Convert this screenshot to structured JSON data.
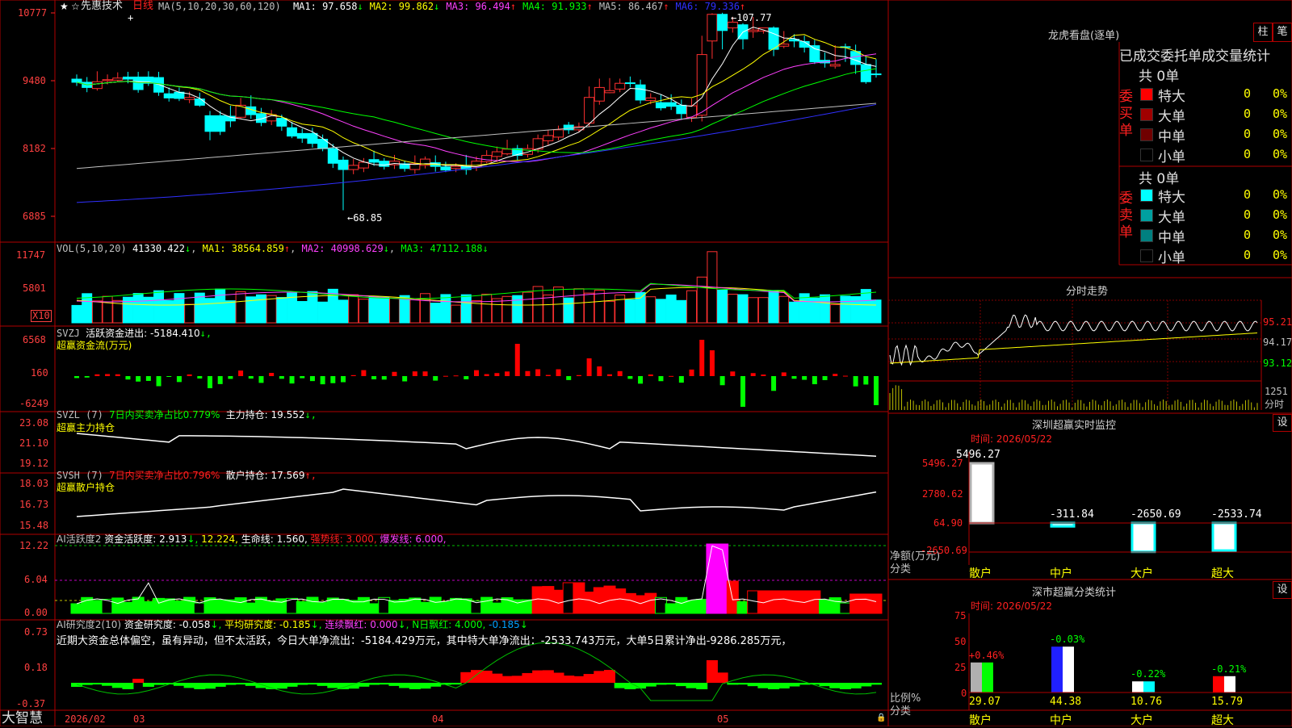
{
  "app": {
    "brand": "大智慧",
    "star_icon": "star-icon",
    "cursor_icon": "cursor-icon"
  },
  "header": {
    "stock": "先惠技术",
    "period": "日线",
    "ma_title": "MA(5,10,20,30,60,120)",
    "ma": [
      {
        "label": "MA1: 97.658",
        "arrow": "↓",
        "color": "#ffffff"
      },
      {
        "label": "MA2: 99.862",
        "arrow": "↓",
        "color": "#ffff00"
      },
      {
        "label": "MA3: 96.494",
        "arrow": "↑",
        "color": "#ff40ff"
      },
      {
        "label": "MA4: 91.933",
        "arrow": "↑",
        "color": "#00ff00"
      },
      {
        "label": "MA5: 86.467",
        "arrow": "↑",
        "color": "#c0c0c0"
      },
      {
        "label": "MA6: 79.336",
        "arrow": "↑",
        "color": "#3030ff"
      }
    ]
  },
  "axis": {
    "price_ticks": [
      "10777",
      "9480",
      "8182",
      "6885"
    ],
    "vol_ticks": [
      "11747",
      "5801"
    ],
    "vol_unit": "X10",
    "svzj_ticks": [
      "6568",
      "160",
      "-6249"
    ],
    "svzl_ticks": [
      "23.08",
      "21.10",
      "19.12"
    ],
    "svsh_ticks": [
      "18.03",
      "16.73",
      "15.48"
    ],
    "ai1_ticks": [
      "12.22",
      "6.04",
      "0.00"
    ],
    "ai2_ticks": [
      "0.73",
      "0.18",
      "-0.37"
    ],
    "dates": [
      "2026/02",
      "03",
      "04",
      "05"
    ]
  },
  "annotations": {
    "high": "107.77",
    "low": "68.85"
  },
  "panels": {
    "vol": {
      "title": "VOL(5,10,20)",
      "v": "41330.422",
      "v_arrow": "↓",
      "ma1": "MA1: 38564.859",
      "ma1_arrow": "↑",
      "ma2": "MA2: 40998.629",
      "ma2_arrow": "↓",
      "ma3": "MA3: 47112.188",
      "ma3_arrow": "↓"
    },
    "svzj": {
      "title": "SVZJ",
      "label": "活跃资金进出: -5184.410",
      "arrow": "↓,",
      "sub": "超赢资金流(万元)"
    },
    "svzl": {
      "title": "SVZL (7)",
      "ratio": "7日内买卖净占比0.779%",
      "hold": "主力持仓: 19.552",
      "arrow": "↓,",
      "sub": "超赢主力持仓"
    },
    "svsh": {
      "title": "SVSH (7)",
      "ratio": "7日内买卖净占比0.796%",
      "hold": "散户持仓: 17.569",
      "arrow": "↑,",
      "sub": "超赢散户持仓"
    },
    "ai1": {
      "title": "AI活跃度2",
      "a": "资金活跃度: 2.913",
      "a_arrow": "↓,",
      "b": "12.224,",
      "c": "生命线: 1.560,",
      "d": "强势线: 3.000,",
      "e": "爆发线: 6.000,"
    },
    "ai2": {
      "title": "AI研究度2(10)",
      "a": "资金研究度: -0.058",
      "a_arrow": "↓,",
      "b": "平均研究度: -0.185",
      "b_arrow": "↓,",
      "c": "连续飘红: 0.000",
      "c_arrow": "↓,",
      "d": "N日飘红: 4.000,",
      "e": "-0.185",
      "e_arrow": "↓",
      "comment": "近期大资金总体偏空，虽有异动，但不太活跃，今日大单净流出：-5184.429万元，其中特大单净流出：-2533.743万元，大单5日累计净出-9286.285万元，"
    }
  },
  "dragon": {
    "title": "龙虎看盘(逐单)",
    "btn_zhu": "柱",
    "btn_bi": "笔",
    "tabs": "已成交委托单成交量统计",
    "buy": {
      "side": "委买单",
      "count": "共 0单",
      "rows": [
        {
          "name": "特大",
          "val": "0",
          "pct": "0%",
          "color": "#ff0000"
        },
        {
          "name": "大单",
          "val": "0",
          "pct": "0%",
          "color": "#a00000"
        },
        {
          "name": "中单",
          "val": "0",
          "pct": "0%",
          "color": "#700000"
        },
        {
          "name": "小单",
          "val": "0",
          "pct": "0%",
          "color": "#000000"
        }
      ]
    },
    "sell": {
      "side": "委卖单",
      "count": "共 0单",
      "rows": [
        {
          "name": "特大",
          "val": "0",
          "pct": "0%",
          "color": "#00ffff"
        },
        {
          "name": "大单",
          "val": "0",
          "pct": "0%",
          "color": "#00a0a0"
        },
        {
          "name": "中单",
          "val": "0",
          "pct": "0%",
          "color": "#008080"
        },
        {
          "name": "小单",
          "val": "0",
          "pct": "0%",
          "color": "#000000"
        }
      ]
    }
  },
  "intraday": {
    "title": "分时走势",
    "r1": "95.21",
    "r2": "94.17",
    "r3": "93.12",
    "vol": "1251",
    "unit": "分时"
  },
  "monitor": {
    "title": "深圳超赢实时监控",
    "btn": "设",
    "time": "时间: 2026/05/22",
    "yticks": [
      "5496.27",
      "2780.62",
      "64.90",
      "-2650.69"
    ],
    "ylabel": "净额(万元)",
    "xlabel": "分类",
    "cats": [
      "散户",
      "中户",
      "大户",
      "超大"
    ],
    "values": [
      5496.27,
      -311.84,
      -2650.69,
      -2533.74
    ],
    "value_labels": [
      "5496.27",
      "-311.84",
      "-2650.69",
      "-2533.74"
    ]
  },
  "classify": {
    "title": "深市超赢分类统计",
    "btn": "设",
    "time": "时间: 2026/05/22",
    "yticks": [
      "75",
      "50",
      "25",
      "0"
    ],
    "ylabel": "比例%",
    "xlabel": "分类",
    "cats": [
      "散户",
      "中户",
      "大户",
      "超大"
    ],
    "ratios": [
      29.07,
      44.38,
      10.76,
      15.79
    ],
    "ratio_labels": [
      "29.07",
      "44.38",
      "10.76",
      "15.79"
    ],
    "changes": [
      "+0.46%",
      "-0.03%",
      "-0.22%",
      "-0.21%"
    ]
  },
  "chart_data": {
    "type": "candlestick",
    "title": "先惠技术 日线",
    "y_axis_range": [
      68.85,
      107.77
    ],
    "price_note": "approximate OHLC per day, read from the chart",
    "candles": [
      [
        95.1,
        94.5,
        96.0,
        93.8
      ],
      [
        94.5,
        93.5,
        95.5,
        92.6
      ],
      [
        93.3,
        94.6,
        96.6,
        92.9
      ],
      [
        94.8,
        95.0,
        96.0,
        94.1
      ],
      [
        94.9,
        95.3,
        96.4,
        94.5
      ],
      [
        95.5,
        95.1,
        96.5,
        94.3
      ],
      [
        95.5,
        93.1,
        96.5,
        92.5
      ],
      [
        95.5,
        94.3,
        96.6,
        93.8
      ],
      [
        95.4,
        92.6,
        96.5,
        91.9
      ],
      [
        92.3,
        91.5,
        93.5,
        90.8
      ],
      [
        92.6,
        91.4,
        93.5,
        90.9
      ],
      [
        91.2,
        91.6,
        92.7,
        90.5
      ],
      [
        91.3,
        90.1,
        92.5,
        89.8
      ],
      [
        88.1,
        85.1,
        89.0,
        83.4
      ],
      [
        88.1,
        85.1,
        89.0,
        84.4
      ],
      [
        88.0,
        87.1,
        90.0,
        85.9
      ],
      [
        87.8,
        90.1,
        91.5,
        87.6
      ],
      [
        89.8,
        88.3,
        92.0,
        87.5
      ],
      [
        88.5,
        86.8,
        89.6,
        86.1
      ],
      [
        87.1,
        88.3,
        89.2,
        86.3
      ],
      [
        87.6,
        86.1,
        88.3,
        85.2
      ],
      [
        85.8,
        84.2,
        86.9,
        83.8
      ],
      [
        84.7,
        83.8,
        85.6,
        82.9
      ],
      [
        84.7,
        82.8,
        85.8,
        82.0
      ],
      [
        83.6,
        81.8,
        84.5,
        81.3
      ],
      [
        81.8,
        79.0,
        82.7,
        78.1
      ],
      [
        79.6,
        77.8,
        80.3,
        70.0
      ],
      [
        77.8,
        78.6,
        79.8,
        76.9
      ],
      [
        78.1,
        79.2,
        80.0,
        77.3
      ],
      [
        79.7,
        79.2,
        81.4,
        78.5
      ],
      [
        79.4,
        78.4,
        80.0,
        77.8
      ],
      [
        78.7,
        79.4,
        80.6,
        77.9
      ],
      [
        78.9,
        78.0,
        79.5,
        77.4
      ],
      [
        77.8,
        78.9,
        80.5,
        77.0
      ],
      [
        78.6,
        79.8,
        80.3,
        78.0
      ],
      [
        79.1,
        78.4,
        80.5,
        77.4
      ],
      [
        78.3,
        77.7,
        79.3,
        77.3
      ],
      [
        78.0,
        78.4,
        79.0,
        77.3
      ],
      [
        78.4,
        77.8,
        80.6,
        76.8
      ],
      [
        78.3,
        79.4,
        80.3,
        77.5
      ],
      [
        79.3,
        80.5,
        81.5,
        79.0
      ],
      [
        80.3,
        81.2,
        82.2,
        79.2
      ],
      [
        80.8,
        81.7,
        83.5,
        80.5
      ],
      [
        81.8,
        80.5,
        82.5,
        79.5
      ],
      [
        80.7,
        81.8,
        82.6,
        80.1
      ],
      [
        81.7,
        83.7,
        84.5,
        81.0
      ],
      [
        83.3,
        84.3,
        85.4,
        82.5
      ],
      [
        84.0,
        85.4,
        86.2,
        83.4
      ],
      [
        86.3,
        85.4,
        86.9,
        84.6
      ],
      [
        85.4,
        86.0,
        86.8,
        84.9
      ],
      [
        86.7,
        91.6,
        93.7,
        86.0
      ],
      [
        90.9,
        93.5,
        95.2,
        90.2
      ],
      [
        92.5,
        92.9,
        95.3,
        92.4
      ],
      [
        93.2,
        94.3,
        95.2,
        92.6
      ],
      [
        94.4,
        94.3,
        95.6,
        93.5
      ],
      [
        94.0,
        91.1,
        95.0,
        90.4
      ],
      [
        91.0,
        91.5,
        92.4,
        90.3
      ],
      [
        90.6,
        89.6,
        92.1,
        89.1
      ],
      [
        90.6,
        89.9,
        92.2,
        89.2
      ],
      [
        90.1,
        88.5,
        91.2,
        87.3
      ],
      [
        87.8,
        90.0,
        91.4,
        86.9
      ],
      [
        88.2,
        99.8,
        103.4,
        87.0
      ],
      [
        102.4,
        107.5,
        107.7,
        99.0
      ],
      [
        107.5,
        104.4,
        107.8,
        100.8
      ],
      [
        104.9,
        106.0,
        107.0,
        104.0
      ],
      [
        105.5,
        102.8,
        105.8,
        100.8
      ],
      [
        104.2,
        104.5,
        107.0,
        103.0
      ],
      [
        104.3,
        104.9,
        104.4,
        103.8
      ],
      [
        104.9,
        100.8,
        105.2,
        99.5
      ],
      [
        101.4,
        101.8,
        104.3,
        101.0
      ],
      [
        102.7,
        102.4,
        103.7,
        101.2
      ],
      [
        102.3,
        101.2,
        103.4,
        100.2
      ],
      [
        101.5,
        98.4,
        102.6,
        98.0
      ],
      [
        98.7,
        98.2,
        100.2,
        97.3
      ],
      [
        97.6,
        97.9,
        101.6,
        97.1
      ],
      [
        101.3,
        101.2,
        101.9,
        98.4
      ],
      [
        100.4,
        97.9,
        101.7,
        96.1
      ],
      [
        97.9,
        94.6,
        99.5,
        94.2
      ],
      [
        96.1,
        96.0,
        98.9,
        95.4
      ]
    ],
    "ma_lines": [
      "MA1",
      "MA2",
      "MA3",
      "MA4",
      "MA5",
      "MA6"
    ],
    "volume_ticks": [
      11747,
      5801
    ],
    "svzj_range": [
      -6249,
      6568
    ],
    "svzl_range": [
      19.12,
      23.08
    ],
    "svsh_range": [
      15.48,
      18.03
    ],
    "ai1_range": [
      0,
      12.22
    ],
    "ai2_range": [
      -0.37,
      0.73
    ]
  }
}
